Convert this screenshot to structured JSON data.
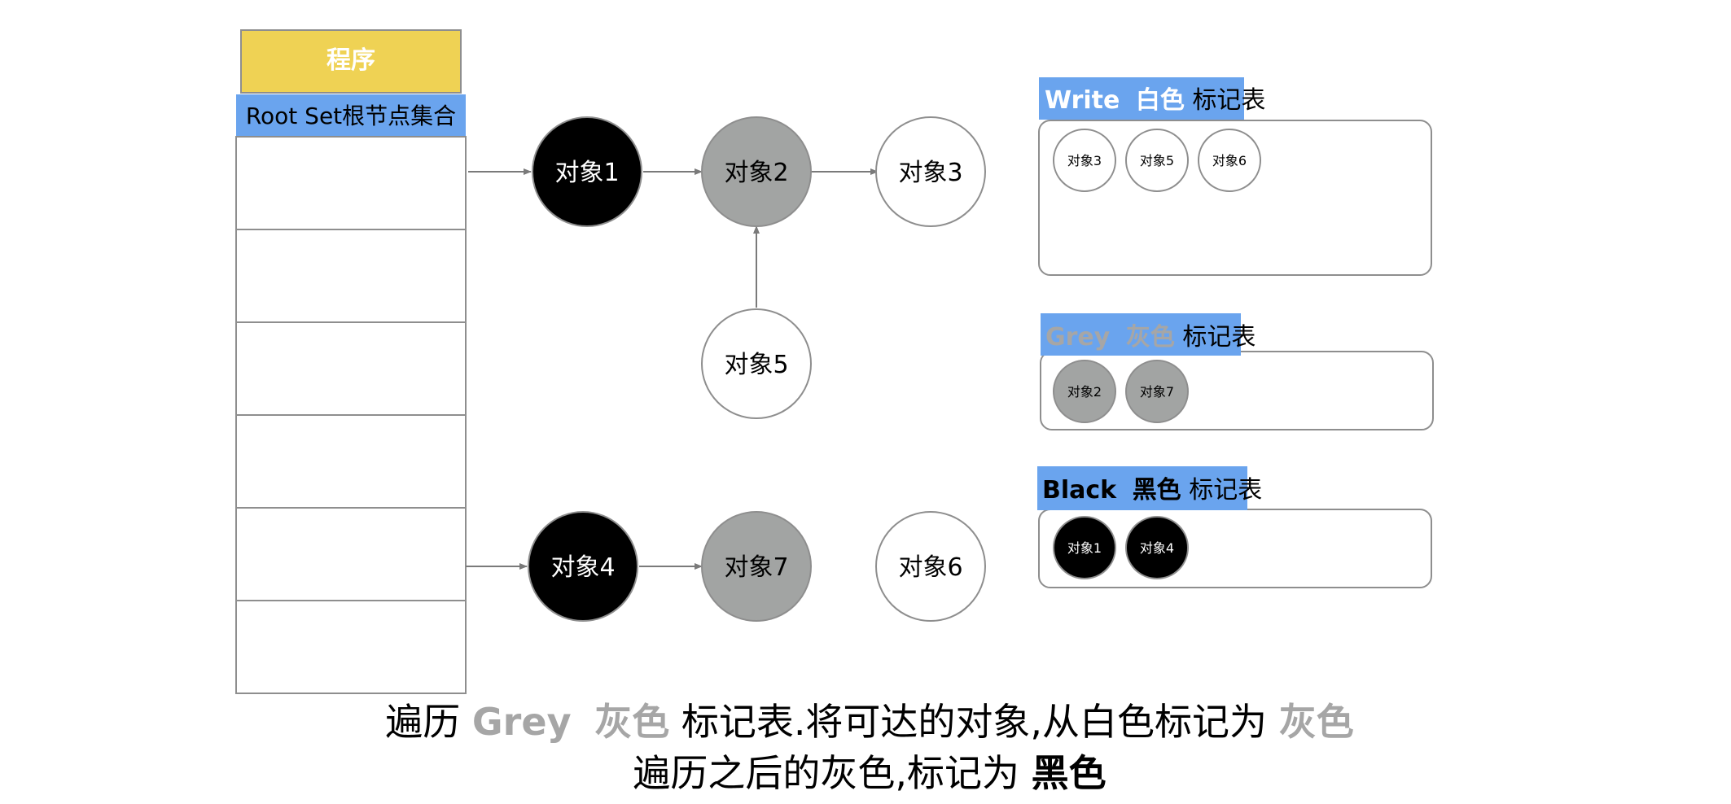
{
  "program_label": "程序",
  "root_set_label": "Root Set根节点集合",
  "root_set_slot_count": 6,
  "objects": {
    "o1": {
      "label": "对象1",
      "color": "black"
    },
    "o2": {
      "label": "对象2",
      "color": "grey"
    },
    "o3": {
      "label": "对象3",
      "color": "white"
    },
    "o4": {
      "label": "对象4",
      "color": "black"
    },
    "o5": {
      "label": "对象5",
      "color": "white"
    },
    "o6": {
      "label": "对象6",
      "color": "white"
    },
    "o7": {
      "label": "对象7",
      "color": "grey"
    }
  },
  "tables": {
    "white": {
      "title_en": "Write",
      "title_color_word": "白色",
      "title_suffix": "标记表",
      "items": [
        "对象3",
        "对象5",
        "对象6"
      ]
    },
    "grey": {
      "title_en": "Grey",
      "title_color_word": "灰色",
      "title_suffix": "标记表",
      "items": [
        "对象2",
        "对象7"
      ]
    },
    "black": {
      "title_en": "Black",
      "title_color_word": "黑色",
      "title_suffix": "标记表",
      "items": [
        "对象1",
        "对象4"
      ]
    }
  },
  "caption": {
    "line1": {
      "prefix": "遍历",
      "grey_en": "Grey",
      "grey_cn": "灰色",
      "middle": "标记表.将可达的对象,从白色标记为",
      "grey_end": "灰色"
    },
    "line2": {
      "prefix": "遍历之后的灰色,标记为",
      "black_end": "黑色"
    }
  },
  "colors": {
    "program_fill": "#EFD254",
    "label_blue": "#6AA4EE",
    "black_node": "#000000",
    "grey_node": "#A2A4A3",
    "white_node": "#FFFFFF",
    "grey_text": "#A6A6A6",
    "line": "#7A7A7A",
    "box_border": "#8E8E8E"
  }
}
